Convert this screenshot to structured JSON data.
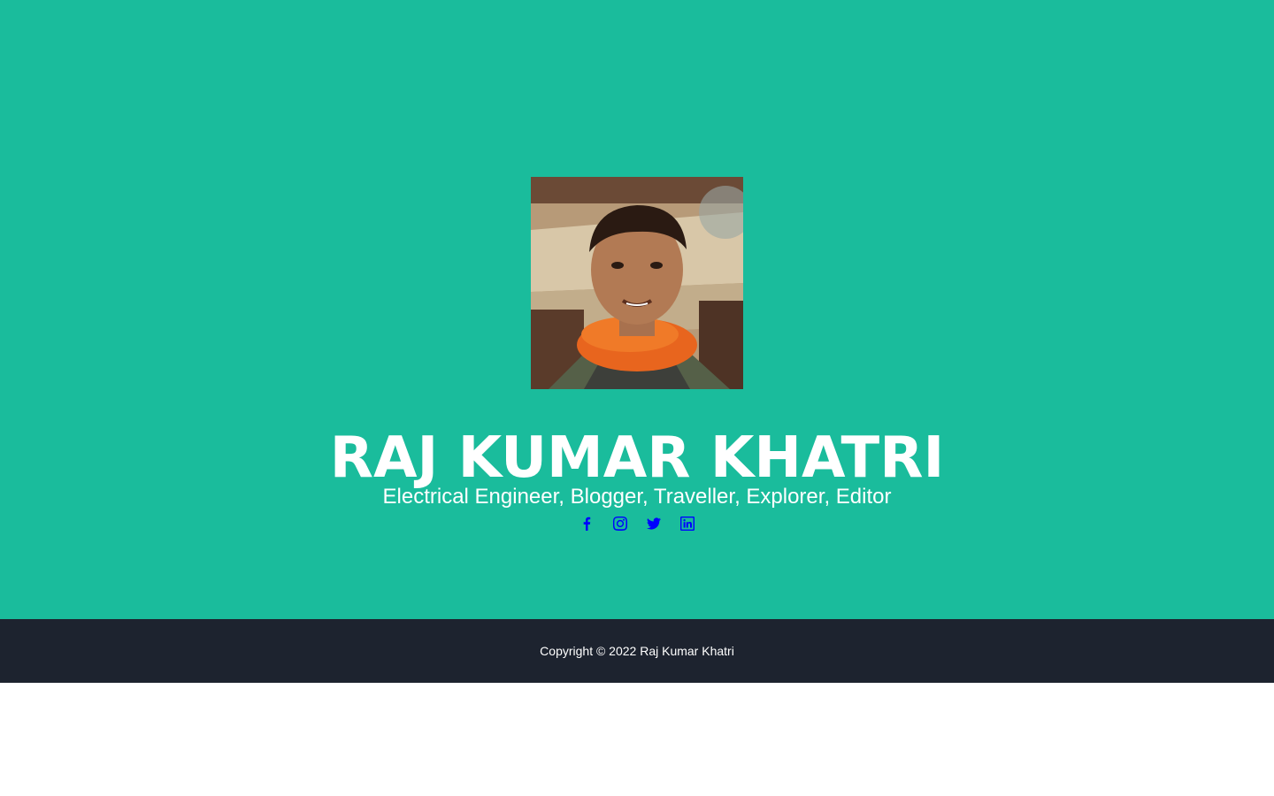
{
  "hero": {
    "name": "RAJ KUMAR KHATRI",
    "tagline": "Electrical Engineer, Blogger, Traveller, Explorer, Editor",
    "background_color": "#1abc9c",
    "avatar_alt": "profile-photo"
  },
  "social": [
    {
      "icon": "facebook-icon"
    },
    {
      "icon": "instagram-icon"
    },
    {
      "icon": "twitter-icon"
    },
    {
      "icon": "linkedin-icon"
    }
  ],
  "social_color": "#0000ff",
  "footer": {
    "copyright": "Copyright © 2022 Raj Kumar Khatri",
    "background_color": "#1d232f"
  }
}
